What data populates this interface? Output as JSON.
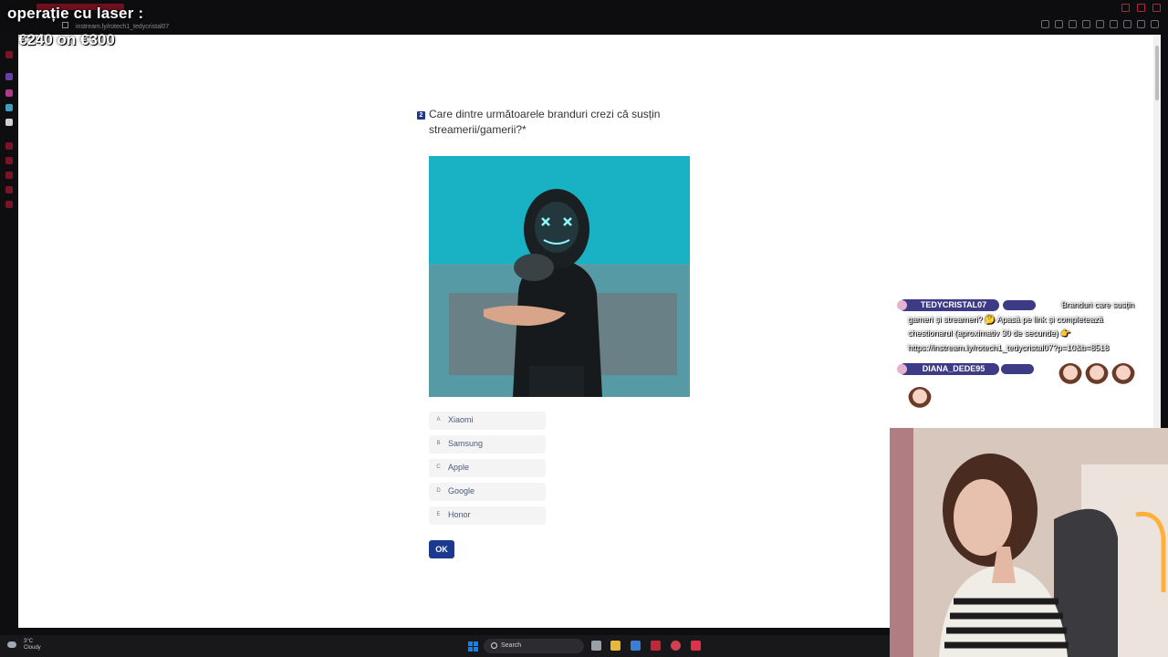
{
  "stream_overlay": {
    "title": "operație cu laser :",
    "price": "€240 on €300"
  },
  "browser": {
    "url": "instream.ly/rotech1_tedycristal07"
  },
  "survey": {
    "question_number": "2",
    "question": "Care dintre următoarele branduri crezi că susțin streamerii/gamerii?*",
    "image_icon": "masked-gamer-photo",
    "options": [
      {
        "key": "A",
        "label": "Xiaomi"
      },
      {
        "key": "B",
        "label": "Samsung"
      },
      {
        "key": "C",
        "label": "Apple"
      },
      {
        "key": "D",
        "label": "Google"
      },
      {
        "key": "E",
        "label": "Honor"
      }
    ],
    "submit_label": "OK",
    "accent_color": "#1b3a8f"
  },
  "chat": {
    "messages": [
      {
        "user": "TEDYCRISTAL07",
        "text": "Branduri care susțin gameri și streameri? 🤔 Apasă pe link și completează chestionarul (aproximativ 30 de secunde) 👉 https://instream.ly/rotech1_tedycristal07?p=10&b=8518"
      },
      {
        "user": "DIANA_DEDE95",
        "text": ""
      }
    ],
    "name_badge_color": "#3d3a86"
  },
  "taskbar": {
    "weather_temp": "3°C",
    "weather_desc": "Cloudy",
    "search_label": "Search"
  }
}
